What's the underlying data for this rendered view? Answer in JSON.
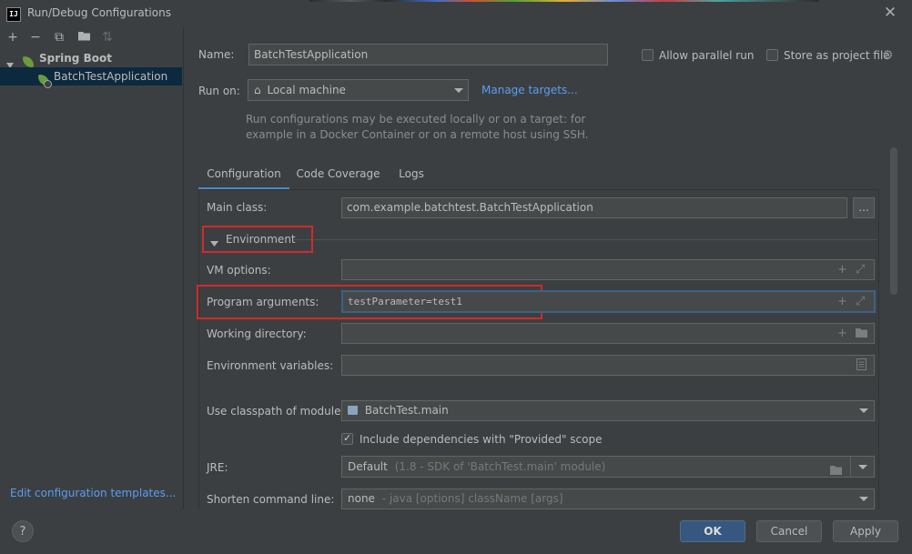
{
  "window": {
    "title": "Run/Debug Configurations",
    "logo_text": "IJ"
  },
  "toolbar": {
    "add": "+",
    "remove": "−",
    "copy": "⧉",
    "folder": "▸",
    "sort": "⇅"
  },
  "tree": {
    "group_label": "Spring Boot",
    "item_label": "BatchTestApplication"
  },
  "edit_templates_link": "Edit configuration templates...",
  "form": {
    "name_label": "Name:",
    "name_value": "BatchTestApplication",
    "allow_parallel_label": "Allow parallel run",
    "store_project_label": "Store as project file",
    "run_on_label": "Run on:",
    "run_on_value": "Local machine",
    "manage_targets": "Manage targets...",
    "help_line1": "Run configurations may be executed locally or on a target: for",
    "help_line2": "example in a Docker Container or on a remote host using SSH."
  },
  "tabs": [
    {
      "label": "Configuration",
      "active": true
    },
    {
      "label": "Code Coverage",
      "active": false
    },
    {
      "label": "Logs",
      "active": false
    }
  ],
  "config": {
    "main_class_label": "Main class:",
    "main_class_value": "com.example.batchtest.BatchTestApplication",
    "browse_label": "...",
    "environment_label": "Environment",
    "vm_options_label": "VM options:",
    "vm_options_value": "",
    "program_args_label": "Program arguments:",
    "program_args_value": "testParameter=test1",
    "working_dir_label": "Working directory:",
    "working_dir_value": "",
    "env_vars_label": "Environment variables:",
    "env_vars_value": "",
    "classpath_label": "Use classpath of module:",
    "classpath_value": "BatchTest.main",
    "include_deps_label": "Include dependencies with \"Provided\" scope",
    "jre_label": "JRE:",
    "jre_value": "Default",
    "jre_detail": "(1.8 - SDK of 'BatchTest.main' module)",
    "shorten_label": "Shorten command line:",
    "shorten_value": "none",
    "shorten_detail": "- java [options] className [args]"
  },
  "buttons": {
    "help": "?",
    "ok": "OK",
    "cancel": "Cancel",
    "apply": "Apply"
  },
  "colors": {
    "background": "#3c3f41",
    "accent": "#4a88c7",
    "link": "#589df6",
    "highlight_box": "#d02b2b"
  }
}
